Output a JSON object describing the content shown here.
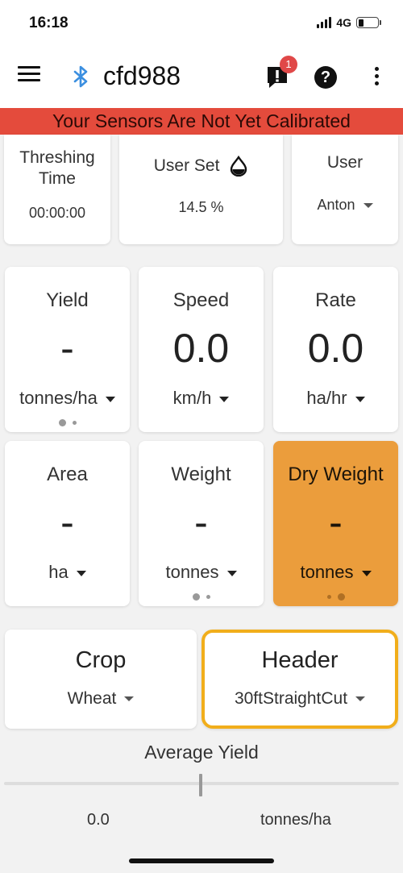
{
  "status_bar": {
    "time": "16:18",
    "network": "4G",
    "battery_level": 0.2
  },
  "app_bar": {
    "title": "cfd988",
    "alert_count": "1",
    "help_glyph": "?",
    "icons": [
      "menu-icon",
      "bluetooth-icon",
      "alert-icon",
      "help-icon",
      "more-vert-icon"
    ]
  },
  "banner": {
    "text": "Your Sensors Are Not Yet Calibrated",
    "color": "#e44b3c"
  },
  "top_cards": {
    "threshing": {
      "title": "Threshing Time",
      "value": "00:00:00"
    },
    "user_set": {
      "title": "User Set",
      "value": "14.5 %"
    },
    "user": {
      "title": "User",
      "value": "Anton"
    }
  },
  "metrics": {
    "yield": {
      "label": "Yield",
      "value": "-",
      "unit": "tonnes/ha"
    },
    "speed": {
      "label": "Speed",
      "value": "0.0",
      "unit": "km/h"
    },
    "rate": {
      "label": "Rate",
      "value": "0.0",
      "unit": "ha/hr"
    },
    "area": {
      "label": "Area",
      "value": "-",
      "unit": "ha"
    },
    "weight": {
      "label": "Weight",
      "value": "-",
      "unit": "tonnes"
    },
    "dry_weight": {
      "label": "Dry Weight",
      "value": "-",
      "unit": "tonnes",
      "highlight_color": "#eb9d3c"
    }
  },
  "selectors": {
    "crop": {
      "title": "Crop",
      "value": "Wheat"
    },
    "header": {
      "title": "Header",
      "value": "30ftStraightCut",
      "focus_color": "#f1ae1b"
    }
  },
  "average_yield": {
    "title": "Average Yield",
    "value": "0.0",
    "unit": "tonnes/ha",
    "slider_position": 0.5
  }
}
